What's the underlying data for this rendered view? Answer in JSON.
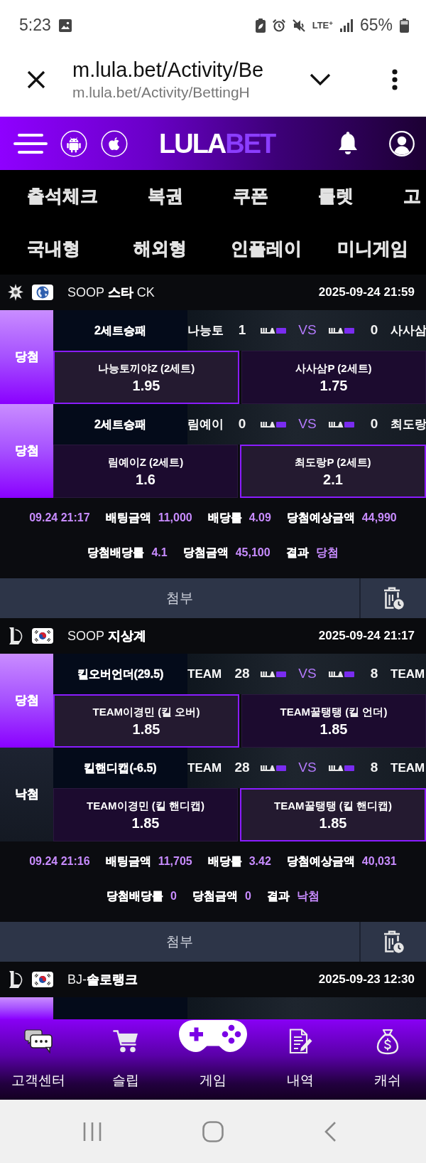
{
  "status_bar": {
    "time": "5:23",
    "network": "LTE$^{+}$",
    "battery": "65%"
  },
  "browser": {
    "title": "m.lula.bet/Activity/Be",
    "url": "m.lula.bet/Activity/BettingH"
  },
  "header": {
    "logo": "LULA",
    "logo_accent": "BET"
  },
  "menu_top": [
    "출석체크",
    "복권",
    "쿠폰",
    "룰렛",
    "고"
  ],
  "menu_games": [
    "국내형",
    "해외형",
    "인플레이",
    "미니게임"
  ],
  "sections": [
    {
      "kind": "globe",
      "league": "SOOP **스타** CK",
      "date": "2025-09-24 21:59",
      "bets": [
        {
          "status": "당첨",
          "won": true,
          "market": "2세트승패",
          "home": "나능토",
          "home_score": "1",
          "vs": "VS",
          "away_score": "0",
          "away": "사사삼",
          "selections": [
            {
              "label": "나능토끼야Z (2세트)",
              "odds": "1.95",
              "selected": true
            },
            {
              "label": "사사삼P (2세트)",
              "odds": "1.75",
              "selected": false
            }
          ]
        },
        {
          "status": "당첨",
          "won": true,
          "market": "2세트승패",
          "home": "림예이",
          "home_score": "0",
          "vs": "VS",
          "away_score": "0",
          "away": "최도랑",
          "selections": [
            {
              "label": "림예이Z (2세트)",
              "odds": "1.6",
              "selected": false
            },
            {
              "label": "최도랑P (2세트)",
              "odds": "2.1",
              "selected": true
            }
          ]
        }
      ],
      "summary": [
        [
          {
            "value": "09.24 21:17"
          },
          {
            "label": "배팅금액",
            "value": "11,000"
          },
          {
            "label": "배당률",
            "value": "4.09"
          },
          {
            "label": "당첨예상금액",
            "value": "44,990"
          }
        ],
        [
          {
            "label": "당첨배당률",
            "value": "4.1"
          },
          {
            "label": "당첨금액",
            "value": "45,100"
          },
          {
            "label": "결과",
            "value": "당첨"
          }
        ]
      ],
      "attach": "첨부"
    },
    {
      "kind": "flag",
      "league": "SOOP **지상계**",
      "date": "2025-09-24 21:17",
      "bets": [
        {
          "status": "당첨",
          "won": true,
          "market": "킬오버언더(29.5)",
          "home": "TEAM",
          "home_score": "28",
          "vs": "VS",
          "away_score": "8",
          "away": "TEAM",
          "selections": [
            {
              "label": "TEAM이경민 (킬 오버)",
              "odds": "1.85",
              "selected": true
            },
            {
              "label": "TEAM꿀탱탱 (킬 언더)",
              "odds": "1.85",
              "selected": false
            }
          ]
        },
        {
          "status": "낙첨",
          "won": false,
          "market": "킬핸디캡(-6.5)",
          "home": "TEAM",
          "home_score": "28",
          "vs": "VS",
          "away_score": "8",
          "away": "TEAM",
          "selections": [
            {
              "label": "TEAM이경민 (킬 핸디캡)",
              "odds": "1.85",
              "selected": false
            },
            {
              "label": "TEAM꿀탱탱 (킬 핸디캡)",
              "odds": "1.85",
              "selected": true
            }
          ]
        }
      ],
      "summary": [
        [
          {
            "value": "09.24 21:16"
          },
          {
            "label": "배팅금액",
            "value": "11,705"
          },
          {
            "label": "배당률",
            "value": "3.42"
          },
          {
            "label": "당첨예상금액",
            "value": "40,031"
          }
        ],
        [
          {
            "label": "당첨배당률",
            "value": "0"
          },
          {
            "label": "당첨금액",
            "value": "0"
          },
          {
            "label": "결과",
            "value": "낙첨"
          }
        ]
      ],
      "attach": "첨부"
    },
    {
      "kind": "flag",
      "league": "BJ-**솔로랭크**",
      "date": "2025-09-23 12:30",
      "bets": [
        {
          "won": true
        }
      ]
    }
  ],
  "bottom_nav": [
    {
      "kind": "support",
      "label": "고객센터"
    },
    {
      "kind": "cart",
      "label": "슬립"
    },
    {
      "kind": "game",
      "label": "게임"
    },
    {
      "kind": "history",
      "label": "내역"
    },
    {
      "kind": "cash",
      "label": "캐쉬"
    }
  ]
}
